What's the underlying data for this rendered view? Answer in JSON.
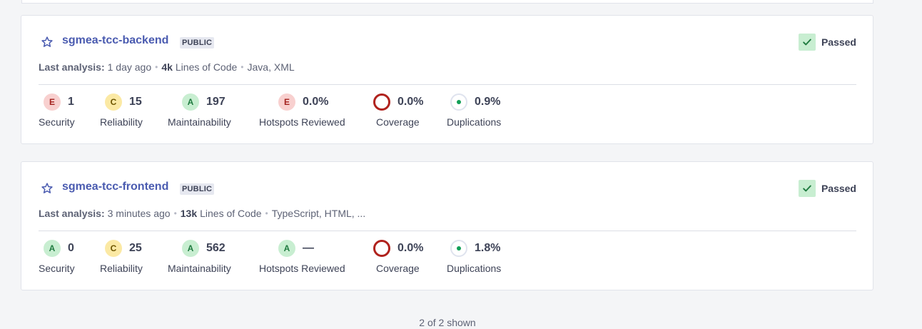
{
  "colors": {
    "rating_E_bg": "#f8d0cf",
    "rating_E_fg": "#a3221e",
    "rating_C_bg": "#fbe9a4",
    "rating_C_fg": "#6e5500",
    "rating_A_bg": "#c8eed1",
    "rating_A_fg": "#1f7a3f",
    "passed_bg": "#c8eed1",
    "link": "#4a5bb0"
  },
  "projects": [
    {
      "name": "sgmea-tcc-backend",
      "visibility": "PUBLIC",
      "quality_gate": "Passed",
      "last_analysis_label": "Last analysis:",
      "last_analysis": "1 day ago",
      "loc_value": "4k",
      "loc_label": "Lines of Code",
      "languages": "Java, XML",
      "metrics": {
        "security": {
          "rating": "E",
          "value": "1",
          "label": "Security"
        },
        "reliability": {
          "rating": "C",
          "value": "15",
          "label": "Reliability"
        },
        "maintainability": {
          "rating": "A",
          "value": "197",
          "label": "Maintainability"
        },
        "hotspots": {
          "rating": "E",
          "value": "0.0%",
          "label": "Hotspots Reviewed"
        },
        "coverage": {
          "value": "0.0%",
          "label": "Coverage"
        },
        "duplications": {
          "value": "0.9%",
          "label": "Duplications"
        }
      }
    },
    {
      "name": "sgmea-tcc-frontend",
      "visibility": "PUBLIC",
      "quality_gate": "Passed",
      "last_analysis_label": "Last analysis:",
      "last_analysis": "3 minutes ago",
      "loc_value": "13k",
      "loc_label": "Lines of Code",
      "languages": "TypeScript, HTML, ...",
      "metrics": {
        "security": {
          "rating": "A",
          "value": "0",
          "label": "Security"
        },
        "reliability": {
          "rating": "C",
          "value": "25",
          "label": "Reliability"
        },
        "maintainability": {
          "rating": "A",
          "value": "562",
          "label": "Maintainability"
        },
        "hotspots": {
          "rating": "A",
          "value": "—",
          "label": "Hotspots Reviewed"
        },
        "coverage": {
          "value": "0.0%",
          "label": "Coverage"
        },
        "duplications": {
          "value": "1.8%",
          "label": "Duplications"
        }
      }
    }
  ],
  "footer": {
    "shown": "2 of 2 shown"
  }
}
